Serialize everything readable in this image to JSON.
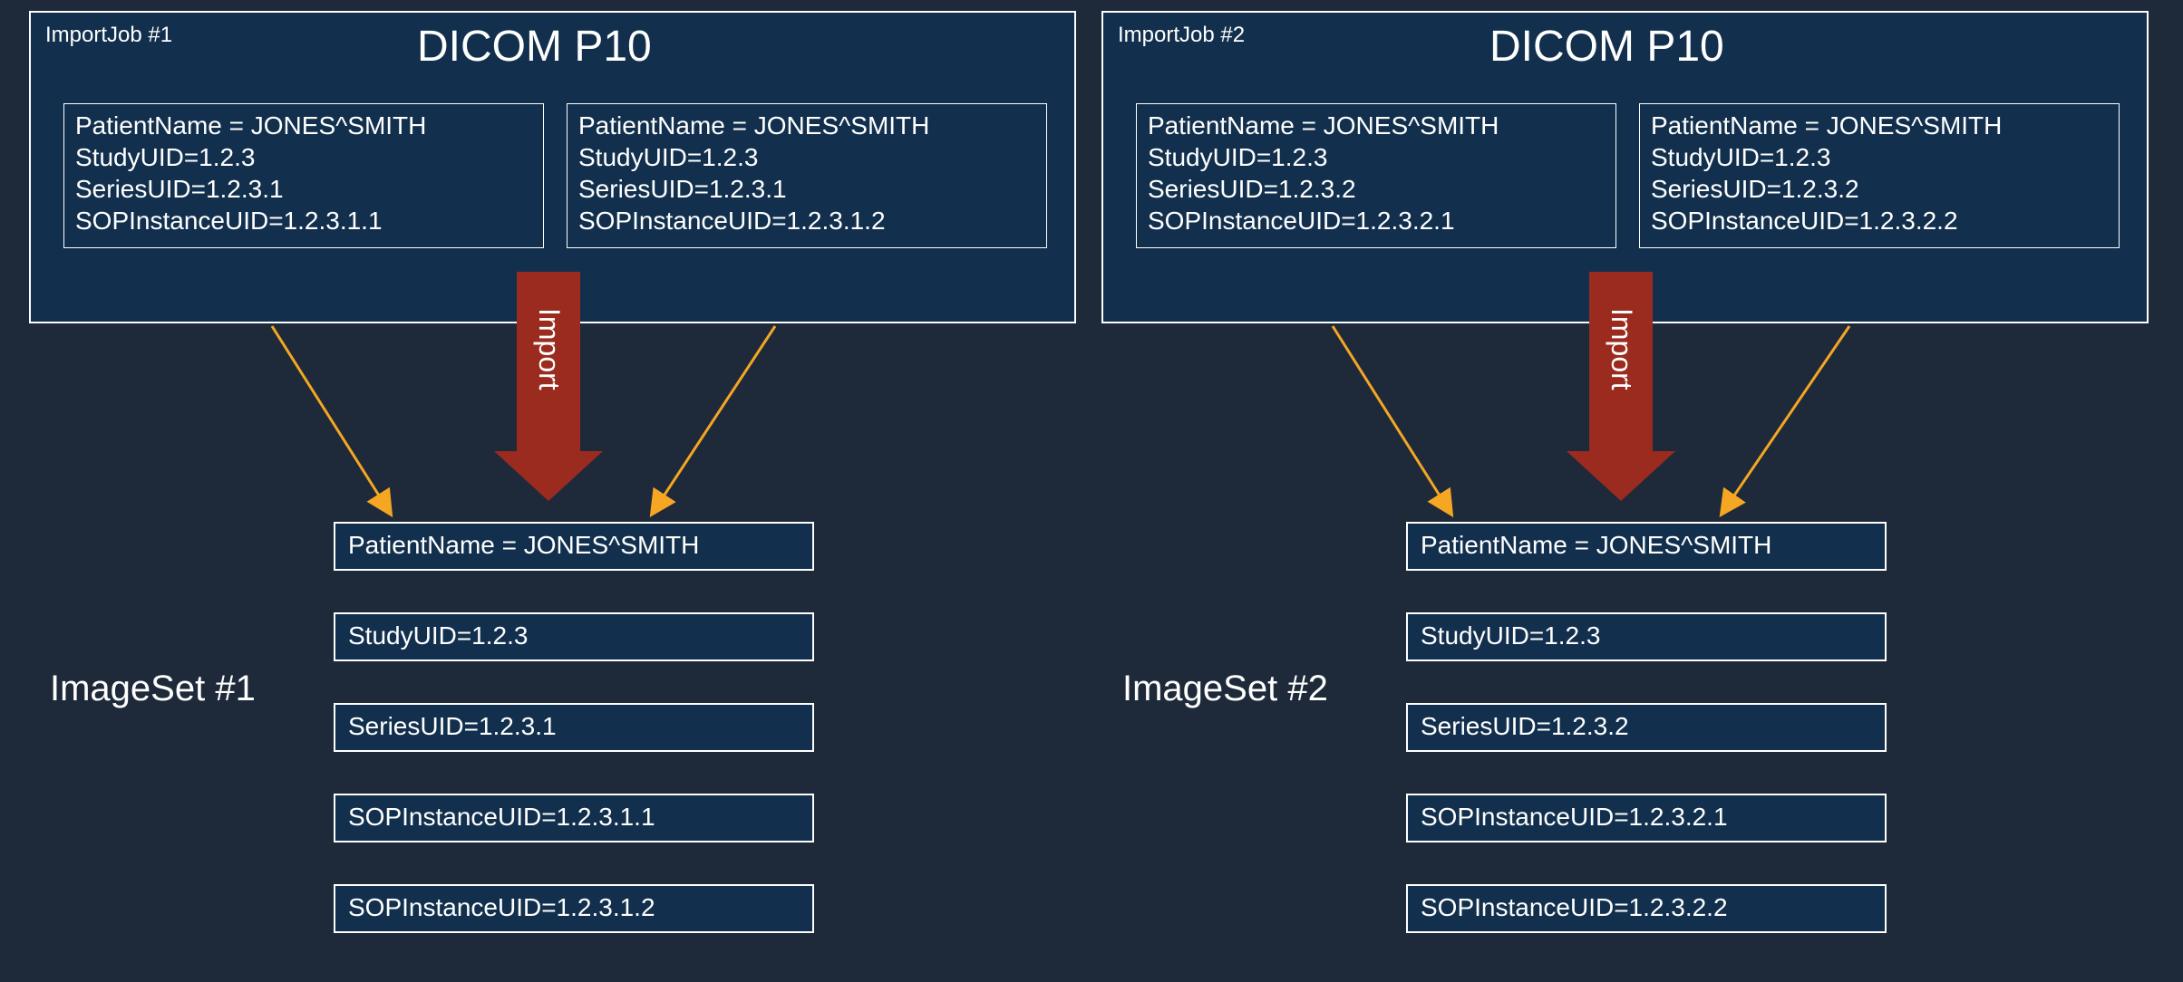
{
  "jobs": [
    {
      "label": "ImportJob #1",
      "title": "DICOM P10",
      "arrowText": "Import",
      "instances": [
        {
          "lines": [
            "PatientName = JONES^SMITH",
            "StudyUID=1.2.3",
            "SeriesUID=1.2.3.1",
            "SOPInstanceUID=1.2.3.1.1"
          ]
        },
        {
          "lines": [
            "PatientName = JONES^SMITH",
            "StudyUID=1.2.3",
            "SeriesUID=1.2.3.1",
            "SOPInstanceUID=1.2.3.1.2"
          ]
        }
      ],
      "imageSet": {
        "label": "ImageSet #1",
        "rows": [
          "PatientName = JONES^SMITH",
          "StudyUID=1.2.3",
          "SeriesUID=1.2.3.1",
          "SOPInstanceUID=1.2.3.1.1",
          "SOPInstanceUID=1.2.3.1.2"
        ]
      }
    },
    {
      "label": "ImportJob #2",
      "title": "DICOM P10",
      "arrowText": "Import",
      "instances": [
        {
          "lines": [
            "PatientName = JONES^SMITH",
            "StudyUID=1.2.3",
            "SeriesUID=1.2.3.2",
            "SOPInstanceUID=1.2.3.2.1"
          ]
        },
        {
          "lines": [
            "PatientName = JONES^SMITH",
            "StudyUID=1.2.3",
            "SeriesUID=1.2.3.2",
            "SOPInstanceUID=1.2.3.2.2"
          ]
        }
      ],
      "imageSet": {
        "label": "ImageSet #2",
        "rows": [
          "PatientName = JONES^SMITH",
          "StudyUID=1.2.3",
          "SeriesUID=1.2.3.2",
          "SOPInstanceUID=1.2.3.2.1",
          "SOPInstanceUID=1.2.3.2.2"
        ]
      }
    }
  ]
}
